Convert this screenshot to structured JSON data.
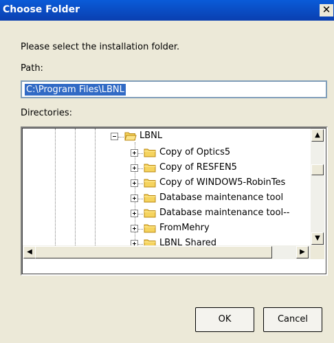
{
  "dialog": {
    "title": "Choose Folder",
    "close_glyph": "✕",
    "instruction": "Please select the installation folder.",
    "path_label": "Path:",
    "path_value": "C:\\Program Files\\LBNL",
    "directories_label": "Directories:",
    "ok_label": "OK",
    "cancel_label": "Cancel"
  },
  "tree": {
    "root": {
      "label": "LBNL",
      "expanded": true,
      "icon": "folder-open-icon"
    },
    "children": [
      {
        "label": "Copy of Optics5",
        "icon": "folder-icon"
      },
      {
        "label": "Copy of RESFEN5",
        "icon": "folder-icon"
      },
      {
        "label": "Copy of WINDOW5-RobinTes",
        "icon": "folder-icon"
      },
      {
        "label": "Database maintenance tool",
        "icon": "folder-icon"
      },
      {
        "label": "Database maintenance tool--",
        "icon": "folder-icon"
      },
      {
        "label": "FromMehry",
        "icon": "folder-icon"
      },
      {
        "label": "LBNL Shared",
        "icon": "folder-icon"
      }
    ]
  },
  "scrollbars": {
    "up_glyph": "▲",
    "down_glyph": "▼",
    "left_glyph": "◀",
    "right_glyph": "▶"
  },
  "colors": {
    "title_bar": "#0a4fc8",
    "selection": "#316ac5",
    "folder": "#f5d35e"
  }
}
